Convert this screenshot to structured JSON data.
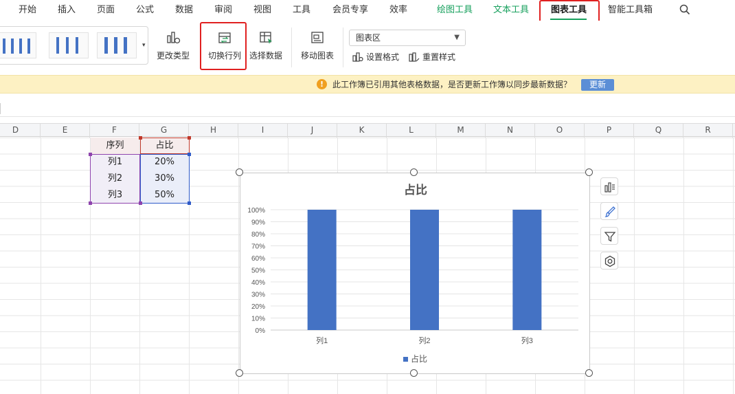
{
  "menu": {
    "tabs": [
      "开始",
      "插入",
      "页面",
      "公式",
      "数据",
      "审阅",
      "视图",
      "工具",
      "会员专享",
      "效率"
    ],
    "context_tabs": [
      "绘图工具",
      "文本工具"
    ],
    "active_tab": "图表工具",
    "smart_tab": "智能工具箱"
  },
  "ribbon": {
    "change_type": "更改类型",
    "switch_row_col": "切换行列",
    "select_data": "选择数据",
    "move_chart": "移动图表",
    "element_select": "图表区",
    "set_format": "设置格式",
    "reset_style": "重置样式"
  },
  "notice": {
    "text": "此工作簿已引用其他表格数据，是否更新工作簿以同步最新数据？",
    "button": "更新"
  },
  "columns": [
    "D",
    "E",
    "F",
    "G",
    "H",
    "I",
    "J",
    "K",
    "L",
    "M",
    "N",
    "O",
    "P",
    "Q",
    "R"
  ],
  "table": {
    "headers": [
      "序列",
      "占比"
    ],
    "rows": [
      [
        "列1",
        "20%"
      ],
      [
        "列2",
        "30%"
      ],
      [
        "列3",
        "50%"
      ]
    ]
  },
  "chart_data": {
    "type": "bar",
    "title": "占比",
    "categories": [
      "列1",
      "列2",
      "列3"
    ],
    "series": [
      {
        "name": "占比",
        "values": [
          1.0,
          1.0,
          1.0
        ]
      }
    ],
    "y_ticks": [
      "0%",
      "10%",
      "20%",
      "30%",
      "40%",
      "50%",
      "60%",
      "70%",
      "80%",
      "90%",
      "100%"
    ],
    "ylim": [
      0,
      1
    ],
    "grid": true,
    "legend": "bottom",
    "color": "#4472c4"
  }
}
